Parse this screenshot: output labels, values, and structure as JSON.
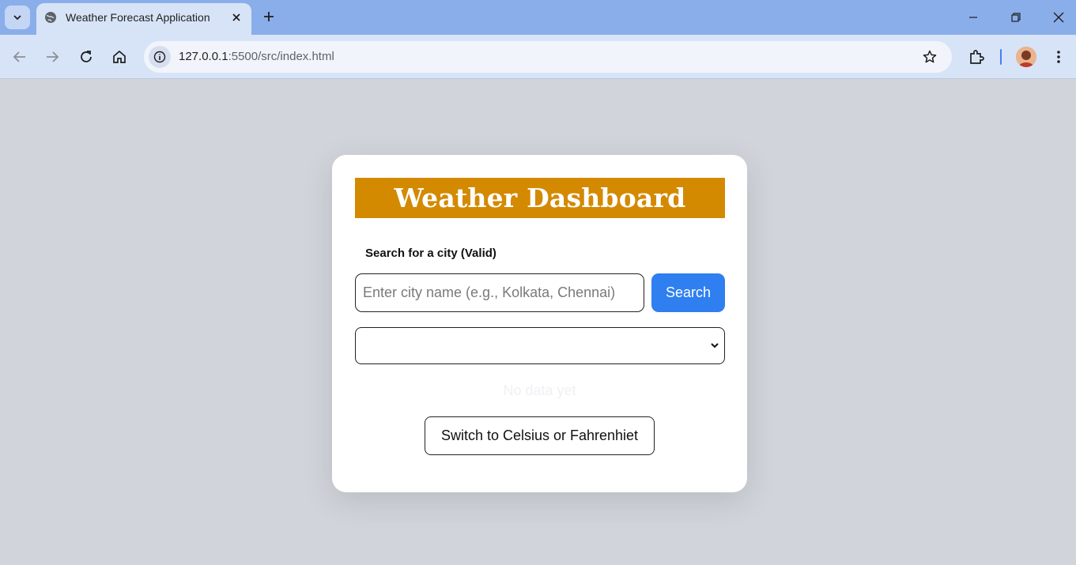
{
  "browser": {
    "tab_title": "Weather Forecast Application",
    "url_host": "127.0.0.1",
    "url_rest": ":5500/src/index.html"
  },
  "icons": {
    "tab_menu": "chevron-down-icon",
    "tab_favicon": "globe-icon",
    "tab_close": "close-icon",
    "new_tab": "plus-icon",
    "minimize": "minimize-icon",
    "restore": "restore-icon",
    "close": "close-icon",
    "back": "back-arrow-icon",
    "forward": "forward-arrow-icon",
    "reload": "reload-icon",
    "home": "home-icon",
    "site_info": "info-icon",
    "bookmark": "star-icon",
    "extensions": "puzzle-icon",
    "menu": "kebab-menu-icon"
  },
  "app": {
    "title": "Weather Dashboard",
    "search_label": "Search for a city (Valid)",
    "input_placeholder": "Enter city name (e.g., Kolkata, Chennai)",
    "input_value": "",
    "search_button": "Search",
    "select_value": "",
    "status_text": "No data yet",
    "unit_toggle_button": "Switch to Celsius or Fahrenhiet"
  },
  "colors": {
    "title_bar": "#d38a00",
    "search_button": "#2f7ff0",
    "page_background": "#d1d5db",
    "tab_strip": "#8aaeea"
  }
}
